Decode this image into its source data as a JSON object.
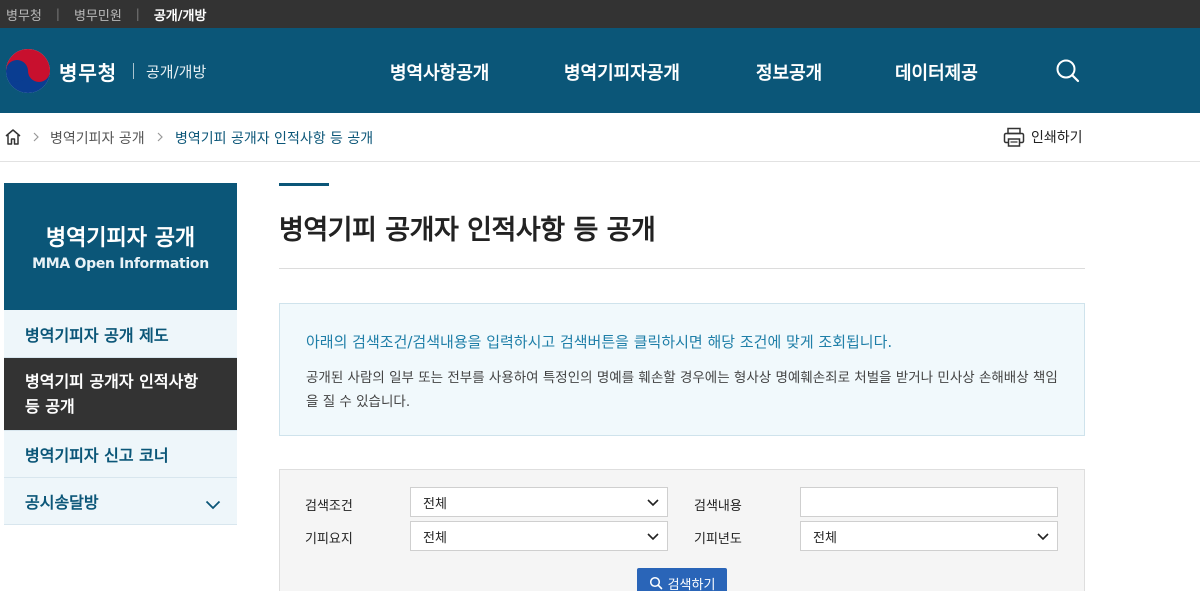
{
  "topbar": {
    "links": [
      "병무청",
      "병무민원",
      "공개/개방"
    ],
    "active_index": 2
  },
  "header": {
    "brand_name": "병무청",
    "brand_sub": "공개/개방",
    "nav": [
      "병역사항공개",
      "병역기피자공개",
      "정보공개",
      "데이터제공"
    ],
    "search_icon": "search-icon",
    "colors": {
      "header_bg": "#0b5678",
      "topbar_bg": "#333333"
    }
  },
  "breadcrumb": {
    "home_icon": "home-icon",
    "items": [
      "병역기피자 공개",
      "병역기피 공개자 인적사항 등 공개"
    ],
    "print_label": "인쇄하기",
    "print_icon": "printer-icon"
  },
  "sidebar": {
    "title": "병역기피자 공개",
    "subtitle": "MMA Open Information",
    "items": [
      {
        "label": "병역기피자 공개 제도",
        "active": false
      },
      {
        "label": "병역기피 공개자 인적사항 등 공개",
        "active": true
      },
      {
        "label": "병역기피자 신고 코너",
        "active": false
      },
      {
        "label": "공시송달방",
        "active": false,
        "expandable": true
      }
    ]
  },
  "main": {
    "title": "병역기피 공개자 인적사항 등 공개",
    "notice": {
      "main": "아래의 검색조건/검색내용을 입력하시고 검색버튼을 클릭하시면 해당 조건에 맞게 조회됩니다.",
      "sub": "공개된 사람의 일부 또는 전부를 사용하여 특정인의 명예를 훼손할 경우에는 형사상 명예훼손죄로 처벌을 받거나 민사상 손해배상 책임을 질 수 있습니다."
    },
    "search_form": {
      "condition_label": "검색조건",
      "condition_value": "전체",
      "keyword_label": "검색내용",
      "keyword_value": "",
      "reason_label": "기피요지",
      "reason_value": "전체",
      "year_label": "기피년도",
      "year_value": "전체",
      "submit_label": "검색하기",
      "submit_color": "#2a65b8"
    }
  }
}
